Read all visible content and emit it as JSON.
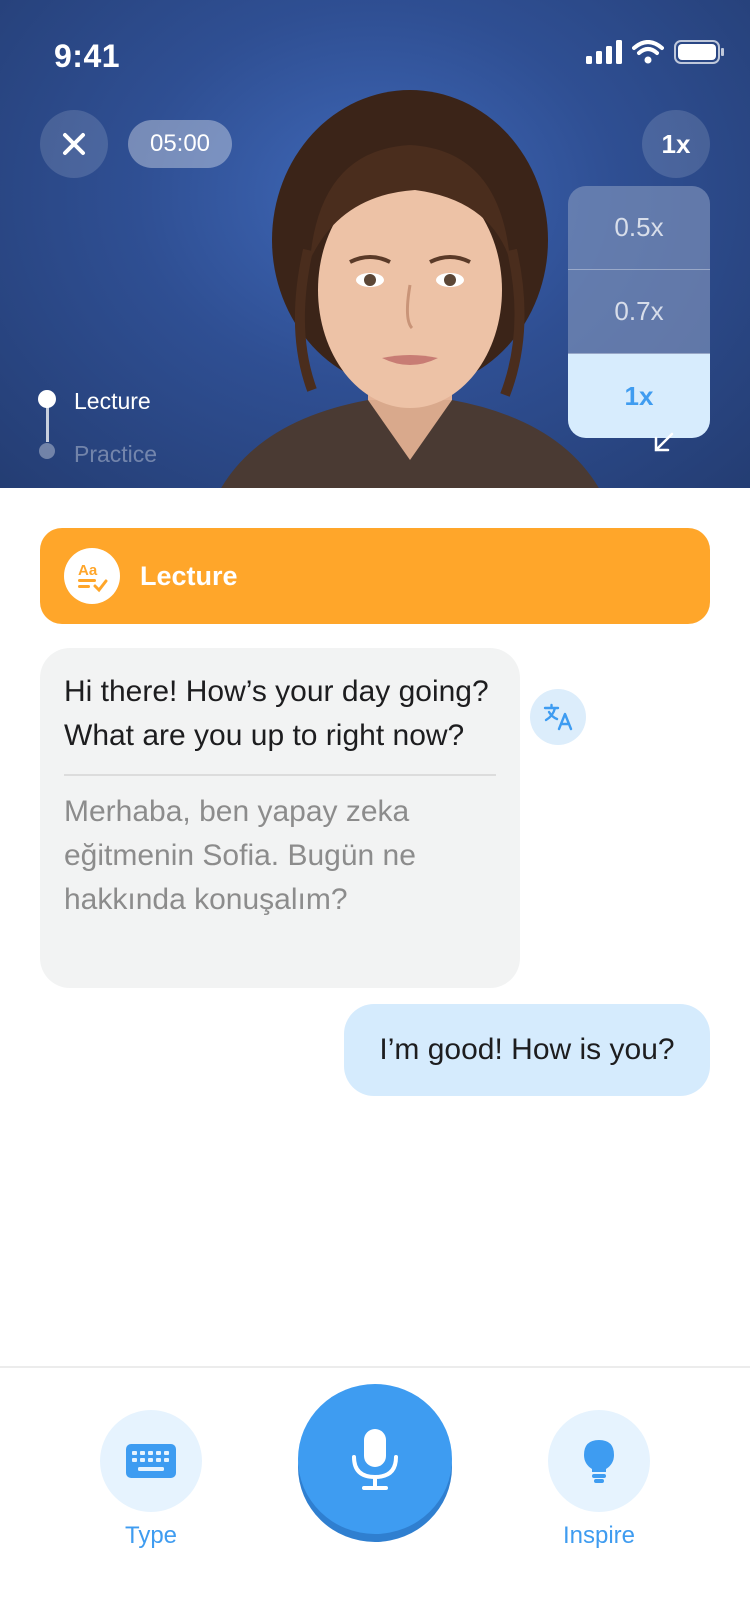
{
  "status_bar": {
    "time": "9:41"
  },
  "video": {
    "timer": "05:00",
    "speed_button_label": "1x",
    "speed_options": [
      "0.5x",
      "0.7x",
      "1x"
    ],
    "selected_speed": "1x",
    "stepper": {
      "step1": "Lecture",
      "step2": "Practice"
    }
  },
  "chat": {
    "banner_title": "Lecture",
    "ai_message": "Hi there! How’s your day going? What are you up to right now?",
    "ai_translation": "Merhaba, ben yapay zeka eğitmenin Sofia. Bugün ne hakkında konuşalım?",
    "user_message": "I’m good! How is you?"
  },
  "bottom_bar": {
    "type_label": "Type",
    "inspire_label": "Inspire"
  },
  "colors": {
    "accent_blue": "#3e9cf1",
    "banner_orange": "#ffa62a",
    "user_bubble": "#d5ebfd",
    "ai_bubble": "#f2f3f3"
  },
  "icons": [
    "close-icon",
    "translate-icon",
    "keyboard-icon",
    "microphone-icon",
    "lightbulb-icon",
    "collapse-arrow-icon",
    "cellular-signal-icon",
    "wifi-icon",
    "battery-icon"
  ]
}
